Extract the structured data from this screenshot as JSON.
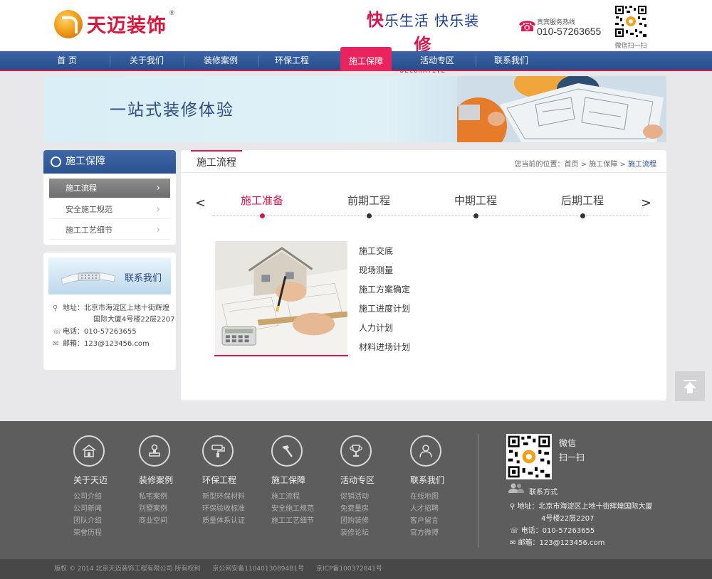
{
  "header": {
    "logo_text": "天迈装饰",
    "slogan_cn_a": "快",
    "slogan_cn_b": "乐生活 快乐装",
    "slogan_cn_c": "修",
    "slogan_en": "HAPPY LIFE, HAPPY DECORATIVE",
    "hotline_label": "贵宾服务热线",
    "hotline_number": "010-57263655",
    "qr_caption": "微信扫一扫"
  },
  "nav": {
    "items": [
      {
        "label": "首 页"
      },
      {
        "label": "关于我们"
      },
      {
        "label": "装修案例"
      },
      {
        "label": "环保工程"
      },
      {
        "label": "施工保障"
      },
      {
        "label": "活动专区"
      },
      {
        "label": "联系我们"
      }
    ],
    "active_index": 4
  },
  "banner": {
    "text": "一站式装修体验"
  },
  "sidebar": {
    "title": "施工保障",
    "items": [
      {
        "label": "施工流程"
      },
      {
        "label": "安全施工规范"
      },
      {
        "label": "施工工艺细节"
      }
    ],
    "contact": {
      "title": "联系我们",
      "address_label": "地址：北京市海淀区上地十街辉煌",
      "address_line2": "国际大厦4号楼22层2207",
      "phone": "电话：010-57263655",
      "email": "邮箱：123@123456.com"
    }
  },
  "main": {
    "title": "施工流程",
    "breadcrumb_prefix": "您当前的位置：首页 > 施工保障 > ",
    "breadcrumb_current": "施工流程",
    "steps": [
      {
        "label": "施工准备"
      },
      {
        "label": "前期工程"
      },
      {
        "label": "中期工程"
      },
      {
        "label": "后期工程"
      }
    ],
    "active_step": 0,
    "prev_arrow": "<",
    "next_arrow": ">",
    "tasks": [
      "施工交底",
      "现场测量",
      "施工方案确定",
      "施工进度计划",
      "人力计划",
      "材料进场计划"
    ]
  },
  "footer": {
    "columns": [
      {
        "title": "关于天迈",
        "icon": "house-icon",
        "links": [
          "公司介绍",
          "公司新闻",
          "团队介绍",
          "荣誉历程"
        ]
      },
      {
        "title": "装修案例",
        "icon": "stamp-icon",
        "links": [
          "私宅案例",
          "别墅案例",
          "商业空间"
        ]
      },
      {
        "title": "环保工程",
        "icon": "paint-roller-icon",
        "links": [
          "新型环保材料",
          "环保验收标准",
          "质量体系认证"
        ]
      },
      {
        "title": "施工保障",
        "icon": "hammer-icon",
        "links": [
          "施工流程",
          "安全施工规范",
          "施工工艺细节"
        ]
      },
      {
        "title": "活动专区",
        "icon": "trophy-icon",
        "links": [
          "促销活动",
          "免费量房",
          "团购装修",
          "装修论坛"
        ]
      },
      {
        "title": "联系我们",
        "icon": "person-icon",
        "links": [
          "在线地图",
          "人才招聘",
          "客户留言",
          "官方微博"
        ]
      }
    ],
    "wechat_a": "微信",
    "wechat_b": "扫一扫",
    "contact_title": "联系方式",
    "address": "地址：北京市海淀区上地十街辉煌国际大厦",
    "address_line2": "4号楼22层2207",
    "phone": "电话：010-57263655",
    "email": "邮箱：123@123456.com"
  },
  "copyright": {
    "text": "版权 © 2014 北京天迈装饰工程有限公司 所有权利",
    "beian": "京公网安备11040130894B1号",
    "icp": "京ICP备100372841号"
  },
  "colors": {
    "brand_red": "#d7174d",
    "nav_blue": "#2f5897",
    "footer_gray": "#5d5d5d"
  }
}
